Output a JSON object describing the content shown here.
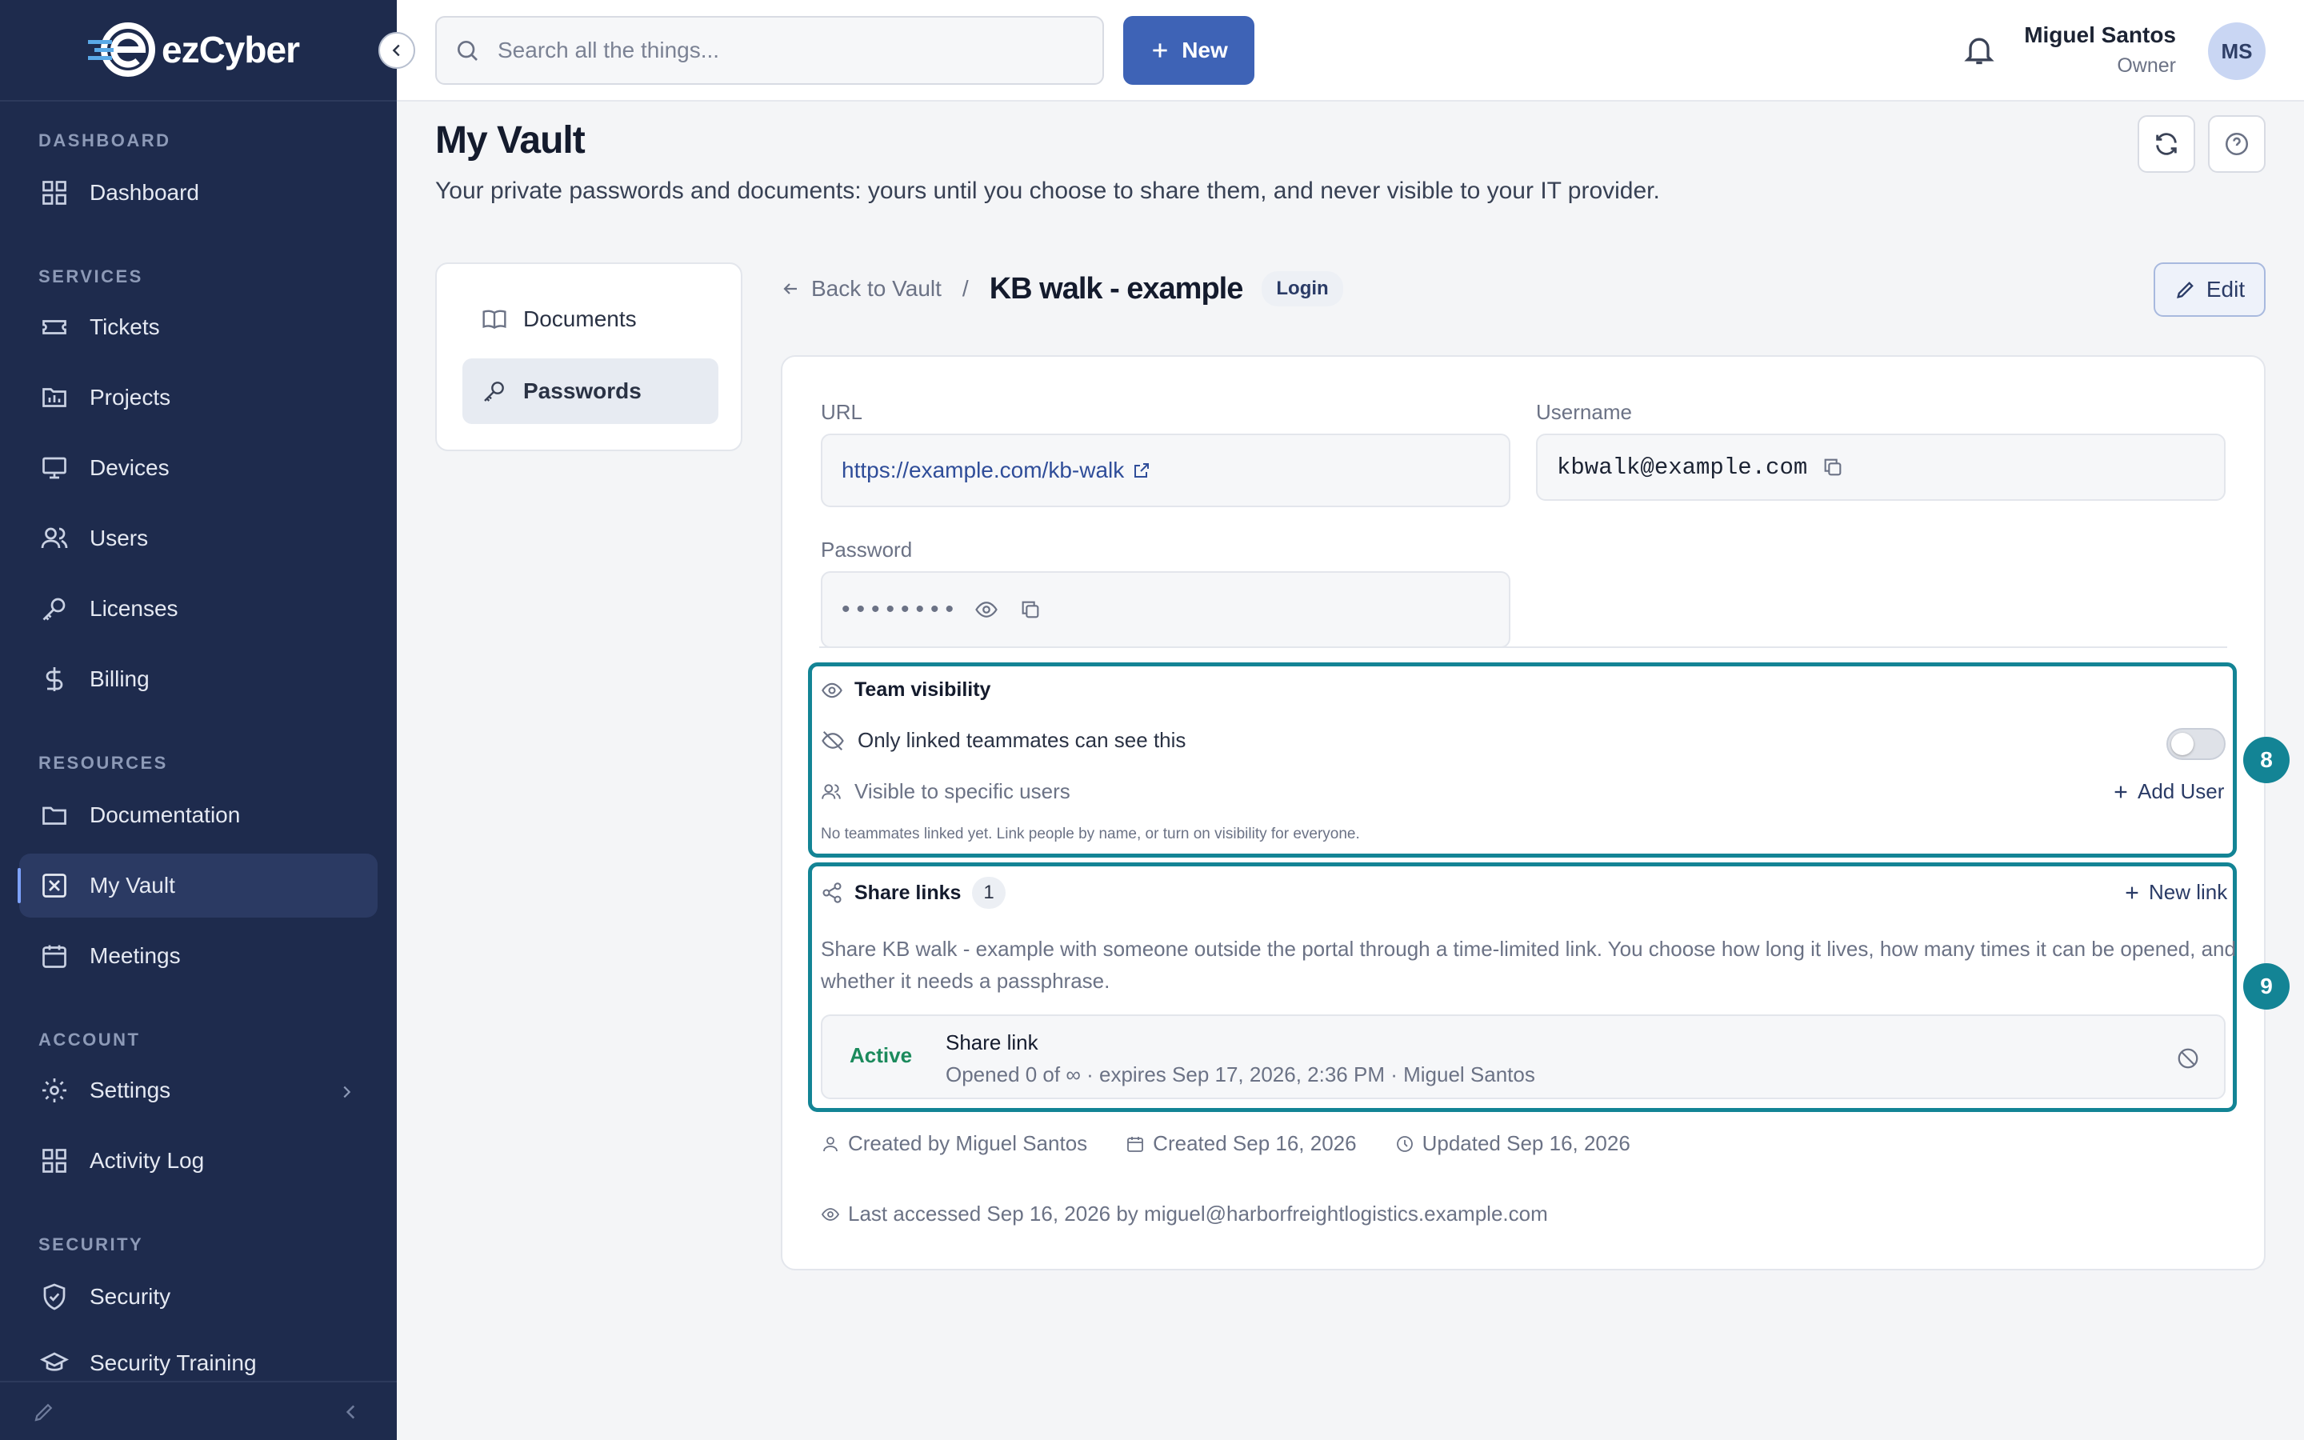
{
  "app": {
    "logo_text": "ezCyber"
  },
  "sidebar": {
    "sections": {
      "dashboard": "DASHBOARD",
      "services": "SERVICES",
      "resources": "RESOURCES",
      "account": "ACCOUNT",
      "security": "SECURITY"
    },
    "items": {
      "dashboard": "Dashboard",
      "tickets": "Tickets",
      "projects": "Projects",
      "devices": "Devices",
      "users": "Users",
      "licenses": "Licenses",
      "billing": "Billing",
      "documentation": "Documentation",
      "my_vault": "My Vault",
      "meetings": "Meetings",
      "settings": "Settings",
      "activity_log": "Activity Log",
      "security": "Security",
      "security_training": "Security Training"
    }
  },
  "topbar": {
    "search_placeholder": "Search all the things...",
    "new_label": "New",
    "user_name": "Miguel Santos",
    "user_role": "Owner",
    "avatar_initials": "MS"
  },
  "page": {
    "title": "My Vault",
    "subtitle": "Your private passwords and documents: yours until you choose to share them, and never visible to your IT provider."
  },
  "vault_tabs": {
    "documents": "Documents",
    "passwords": "Passwords"
  },
  "breadcrumb": {
    "back": "Back to Vault",
    "sep": "/",
    "title": "KB walk - example",
    "badge": "Login"
  },
  "edit_label": "Edit",
  "fields": {
    "url_label": "URL",
    "url_value": "https://example.com/kb-walk",
    "username_label": "Username",
    "username_value": "kbwalk@example.com",
    "password_label": "Password",
    "password_mask": "••••••••"
  },
  "team_visibility": {
    "title": "Team visibility",
    "only_linked": "Only linked teammates can see this",
    "toggle_on": false,
    "visible_users": "Visible to specific users",
    "add_user": "Add User",
    "note": "No teammates linked yet. Link people by name, or turn on visibility for everyone.",
    "marker": "8"
  },
  "share_links": {
    "title": "Share links",
    "count": "1",
    "new_link": "New link",
    "description": "Share KB walk - example with someone outside the portal through a time-limited link. You choose how long it lives, how many times it can be opened, and whether it needs a passphrase.",
    "marker": "9",
    "links": [
      {
        "status": "Active",
        "name": "Share link",
        "meta": "Opened 0 of ∞ · expires Sep 17, 2026, 2:36 PM · Miguel Santos"
      }
    ]
  },
  "meta": {
    "created_by": "Created by Miguel Santos",
    "created": "Created Sep 16, 2026",
    "updated": "Updated Sep 16, 2026",
    "last_accessed": "Last accessed Sep 16, 2026 by miguel@harborfreightlogistics.example.com"
  },
  "colors": {
    "sidebar_bg": "#1e2b4d",
    "accent": "#3e63b6",
    "highlight": "#138495",
    "active_green": "#1b8a5c"
  }
}
